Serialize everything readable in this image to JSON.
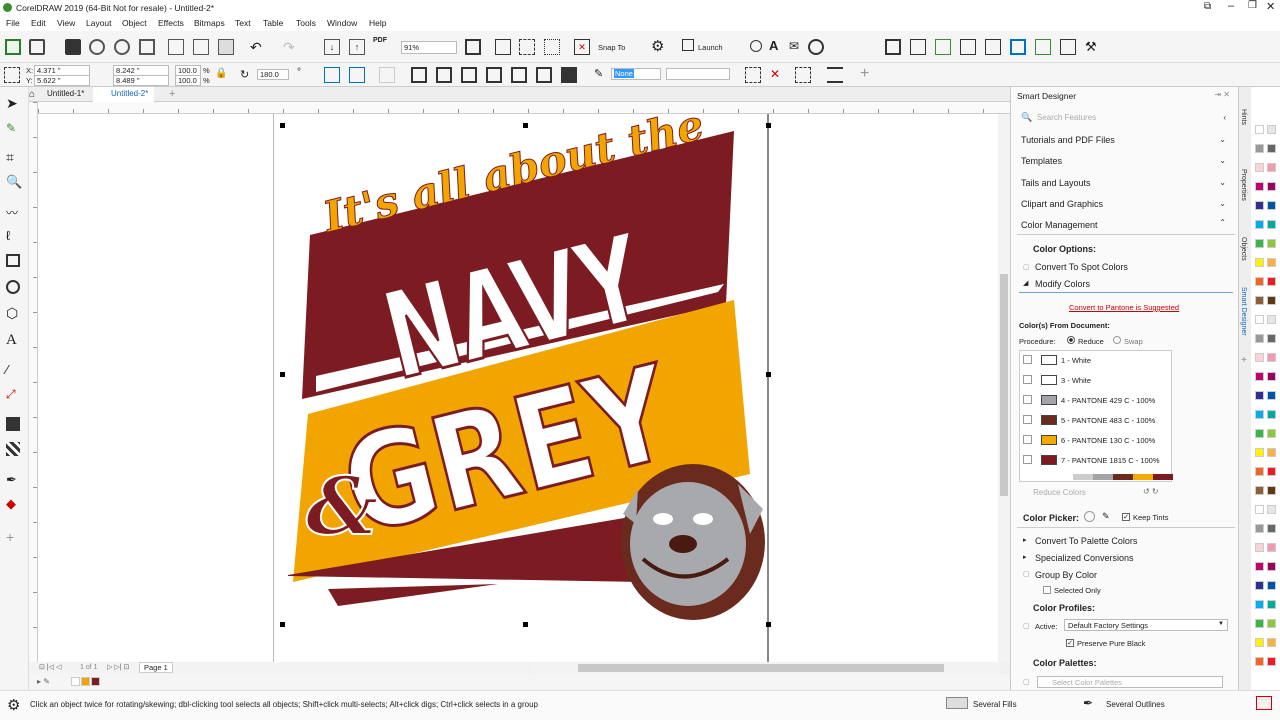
{
  "window": {
    "title": "CorelDRAW 2019 (64-Bit Not for resale) - Untitled-2*"
  },
  "menu": [
    "File",
    "Edit",
    "View",
    "Layout",
    "Object",
    "Effects",
    "Bitmaps",
    "Text",
    "Table",
    "Tools",
    "Window",
    "Help"
  ],
  "toolbar": {
    "zoom": "91%",
    "snap_to": "Snap To",
    "launch": "Launch"
  },
  "propertybar": {
    "x": "4.371 \"",
    "y": "5.622 \"",
    "w": "8.242 \"",
    "h": "8.489 \"",
    "sx": "100.0",
    "sy": "100.0",
    "pct": "%",
    "angle": "180.0",
    "outline_width": "None"
  },
  "tabs": [
    "Untitled-1*",
    "Untitled-2*"
  ],
  "artwork": {
    "line1": "It's all about the",
    "line2": "NAVY",
    "line3": "GREY",
    "amp": "&"
  },
  "page_nav": {
    "count": "1 of 1",
    "page": "Page 1"
  },
  "status": {
    "hint": "Click an object twice for rotating/skewing; dbl-clicking tool selects all objects; Shift+click multi-selects; Alt+click digs; Ctrl+click selects in a group",
    "fill": "Several Fills",
    "outline": "Several Outlines"
  },
  "docker": {
    "title": "Smart Designer",
    "search_placeholder": "Search Features",
    "sections": [
      "Tutorials and PDF Files",
      "Templates",
      "Tails and Layouts",
      "Clipart and Graphics",
      "Color Management"
    ],
    "color_options": "Color Options:",
    "convert_spot": "Convert To Spot Colors",
    "modify_colors": "Modify Colors",
    "pantone_link": "Convert to Pantone is Suggested",
    "colors_from_doc": "Color(s) From Document:",
    "procedure": "Procedure:",
    "reduce": "Reduce",
    "swap": "Swap",
    "colors": [
      {
        "label": "1 - White",
        "hex": "#ffffff"
      },
      {
        "label": "3 - White",
        "hex": "#ffffff"
      },
      {
        "label": "4 - PANTONE 429 C - 100%",
        "hex": "#a2a4a7"
      },
      {
        "label": "5 - PANTONE 483 C - 100%",
        "hex": "#6b2a1e"
      },
      {
        "label": "6 - PANTONE 130 C - 100%",
        "hex": "#f2a900"
      },
      {
        "label": "7 - PANTONE 1815 C - 100%",
        "hex": "#7c1c22"
      }
    ],
    "reduce_colors": "Reduce Colors",
    "color_picker": "Color Picker:",
    "keep_tints": "Keep Tints",
    "convert_palette": "Convert To Palette Colors",
    "specialized": "Specialized Conversions",
    "group_by_color": "Group By Color",
    "selected_only": "Selected Only",
    "color_profiles": "Color Profiles:",
    "active": "Active:",
    "active_value": "Default Factory Settings",
    "preserve_black": "Preserve Pure Black",
    "color_palettes": "Color Palettes:",
    "select_palettes": "Select Color Palettes"
  },
  "side_tabs": [
    "Hints",
    "Properties",
    "Objects",
    "Smart Designer"
  ],
  "colors": {
    "maroon": "#7c1c22",
    "gold": "#f2a500",
    "grey": "#a7a9ac",
    "brown": "#6b2a1e"
  },
  "palette": [
    "#ffffff",
    "#e6e6e6",
    "#c8c8c8",
    "#999999",
    "#666666",
    "#000000",
    "#f9d3d8",
    "#f39ab0",
    "#ec008c",
    "#c2006e",
    "#9e005d",
    "#662d91",
    "#2e3192",
    "#0054a6",
    "#0072bc",
    "#00aeef",
    "#00a99d",
    "#00a651",
    "#39b54a",
    "#8dc63f",
    "#d7df23",
    "#fff200",
    "#fbb040",
    "#f7941d",
    "#f26522",
    "#ed1c24",
    "#be1e2d",
    "#8b5e3c",
    "#603913",
    "#c69c6d"
  ]
}
